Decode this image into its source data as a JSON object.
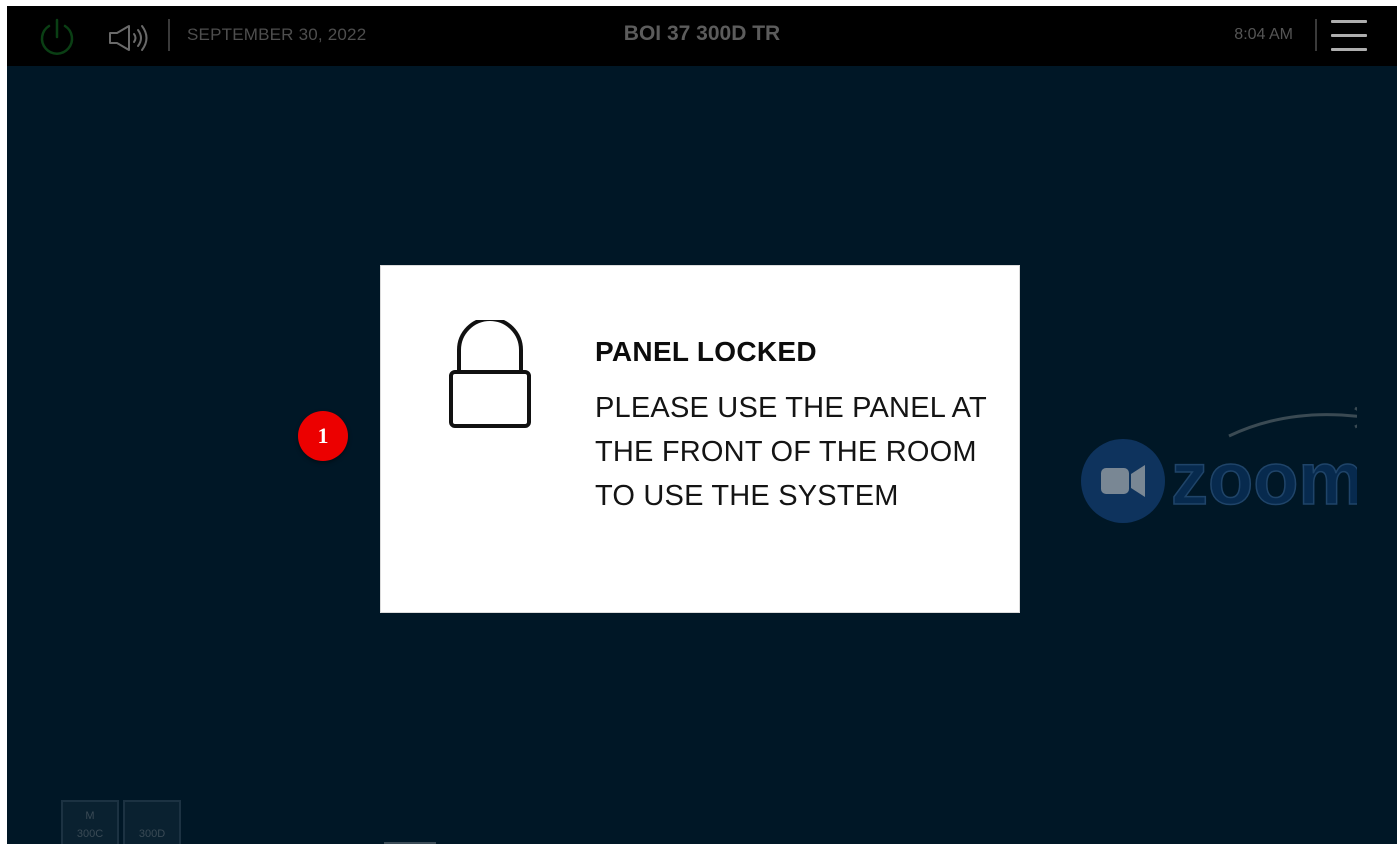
{
  "header": {
    "date": "SEPTEMBER 30, 2022",
    "room_title": "BOI 37 300D TR",
    "time": "8:04 AM"
  },
  "icons": {
    "power": "power-icon",
    "volume": "speaker-icon",
    "menu": "hamburger-menu-icon",
    "lock": "padlock-icon",
    "zoom_logo": "zoom-logo",
    "zoom_arrow": "arrow-icon"
  },
  "zoom": {
    "wordmark": "zoom"
  },
  "modal": {
    "title": "PANEL LOCKED",
    "message": "PLEASE USE THE PANEL AT THE FRONT OF THE ROOM TO USE THE SYSTEM"
  },
  "marker": {
    "label": "1"
  },
  "source_buttons": [
    {
      "line1": "M",
      "line2": "300C"
    },
    {
      "line1": "",
      "line2": "300D"
    }
  ],
  "colors": {
    "background": "#001726",
    "topbar": "#000000",
    "power_green": "#0a3f14",
    "marker_red": "#ec0000",
    "zoom_blue": "#2d8cff"
  }
}
